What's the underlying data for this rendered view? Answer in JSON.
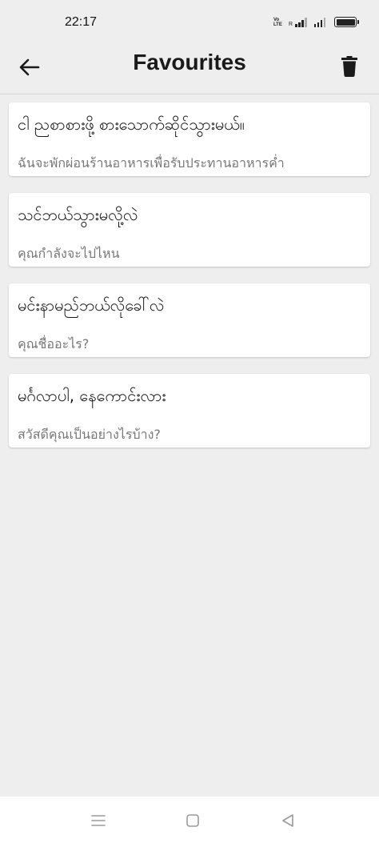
{
  "status_bar": {
    "time": "22:17",
    "volte": "Vo LTE",
    "roaming": "R"
  },
  "app_bar": {
    "title": "Favourites",
    "back_icon": "arrow-left-icon",
    "delete_icon": "trash-icon"
  },
  "favourites": [
    {
      "source": "ငါ ညစာစားဖို့ စားသောက်ဆိုင်သွားမယ်။",
      "translation": "ฉันจะพักผ่อนร้านอาหารเพื่อรับประทานอาหารค่ำ"
    },
    {
      "source": "သင်ဘယ်သွားမလို့လဲ",
      "translation": "คุณกำลังจะไปไหน"
    },
    {
      "source": "မင်းနာမည်ဘယ်လိုခေါ်လဲ",
      "translation": "คุณชื่ออะไร?"
    },
    {
      "source": "မင်္ဂလာပါ, နေကောင်းလား",
      "translation": "สวัสดีคุณเป็นอย่างไรบ้าง?"
    }
  ],
  "nav_bar": {
    "menu_icon": "menu-icon",
    "home_icon": "square-home-icon",
    "back_icon": "triangle-back-icon"
  },
  "colors": {
    "background": "#eeeeee",
    "card": "#ffffff",
    "secondary_text": "#777777"
  }
}
